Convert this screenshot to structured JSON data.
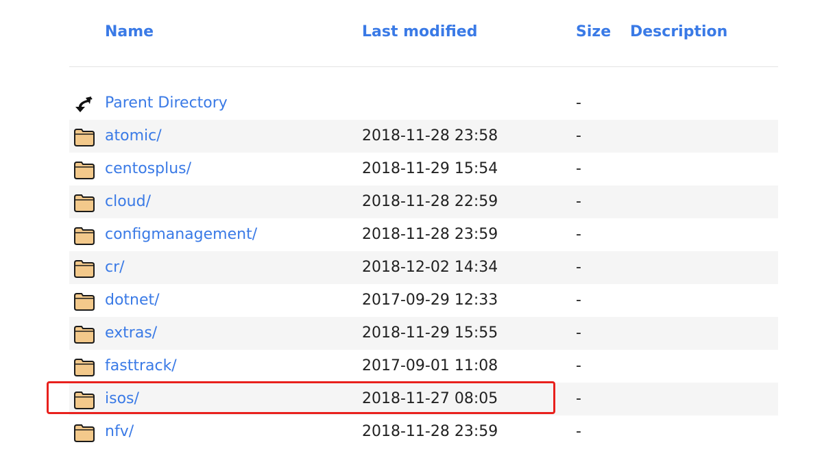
{
  "columns": {
    "name": "Name",
    "last_modified": "Last modified",
    "size": "Size",
    "description": "Description"
  },
  "rows": [
    {
      "name": "Parent Directory",
      "modified": "",
      "size": "-",
      "icon": "back-arrow-icon"
    },
    {
      "name": "atomic/",
      "modified": "2018-11-28 23:58",
      "size": "-",
      "icon": "folder-icon"
    },
    {
      "name": "centosplus/",
      "modified": "2018-11-29 15:54",
      "size": "-",
      "icon": "folder-icon"
    },
    {
      "name": "cloud/",
      "modified": "2018-11-28 22:59",
      "size": "-",
      "icon": "folder-icon"
    },
    {
      "name": "configmanagement/",
      "modified": "2018-11-28 23:59",
      "size": "-",
      "icon": "folder-icon"
    },
    {
      "name": "cr/",
      "modified": "2018-12-02 14:34",
      "size": "-",
      "icon": "folder-icon"
    },
    {
      "name": "dotnet/",
      "modified": "2017-09-29 12:33",
      "size": "-",
      "icon": "folder-icon"
    },
    {
      "name": "extras/",
      "modified": "2018-11-29 15:55",
      "size": "-",
      "icon": "folder-icon"
    },
    {
      "name": "fasttrack/",
      "modified": "2017-09-01 11:08",
      "size": "-",
      "icon": "folder-icon"
    },
    {
      "name": "isos/",
      "modified": "2018-11-27 08:05",
      "size": "-",
      "icon": "folder-icon",
      "highlighted": true
    },
    {
      "name": "nfv/",
      "modified": "2018-11-28 23:59",
      "size": "-",
      "icon": "folder-icon"
    }
  ],
  "colors": {
    "link": "#3a7ae6",
    "highlight": "#e8201c",
    "alt_row": "#f5f5f5"
  }
}
